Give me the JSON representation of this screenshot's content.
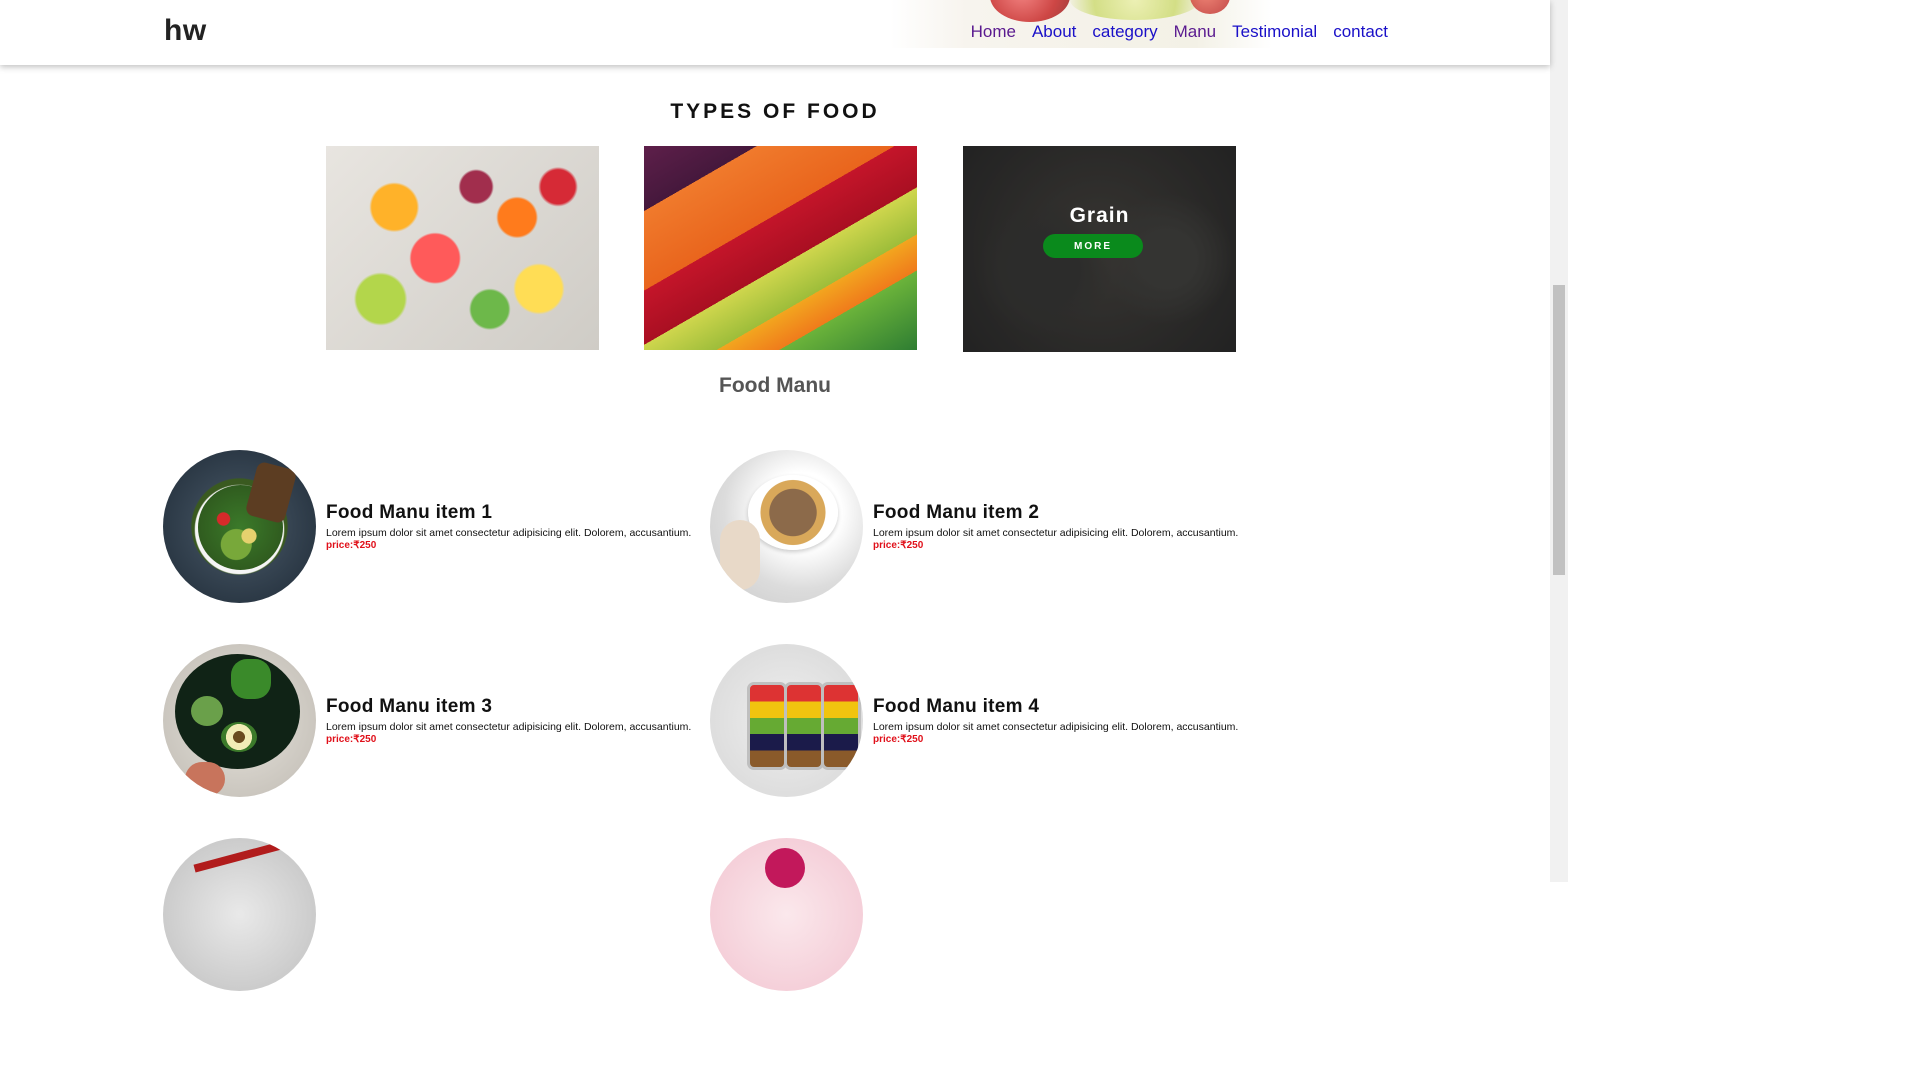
{
  "navbar": {
    "logo": "hw",
    "links": [
      {
        "label": "Home",
        "visited": true
      },
      {
        "label": "About",
        "visited": false
      },
      {
        "label": "category",
        "visited": false
      },
      {
        "label": "Manu",
        "visited": true
      },
      {
        "label": "Testimonial",
        "visited": false
      },
      {
        "label": "contact",
        "visited": false
      }
    ]
  },
  "types_section": {
    "title": "TYPES OF FOOD",
    "cards": [
      {
        "image": "fruits-platter"
      },
      {
        "image": "vegetable-rows"
      },
      {
        "image": "grain-bowls",
        "title": "Grain",
        "button": "MORE"
      }
    ]
  },
  "menu": {
    "heading": "Food Manu",
    "items": [
      {
        "title": "Food Manu item 1",
        "desc": "Lorem ipsum dolor sit amet consectetur adipisicing elit. Dolorem, accusantium.",
        "price": "price:₹250"
      },
      {
        "title": "Food Manu item 2",
        "desc": "Lorem ipsum dolor sit amet consectetur adipisicing elit. Dolorem, accusantium.",
        "price": "price:₹250"
      },
      {
        "title": "Food Manu item 3",
        "desc": "Lorem ipsum dolor sit amet consectetur adipisicing elit. Dolorem, accusantium.",
        "price": "price:₹250"
      },
      {
        "title": "Food Manu item 4",
        "desc": "Lorem ipsum dolor sit amet consectetur adipisicing elit. Dolorem, accusantium.",
        "price": "price:₹250"
      }
    ]
  },
  "colors": {
    "link": "#1a10c8",
    "link_visited": "#5a1a8f",
    "price": "#e0101a",
    "more_button": "#0a8a1c"
  }
}
